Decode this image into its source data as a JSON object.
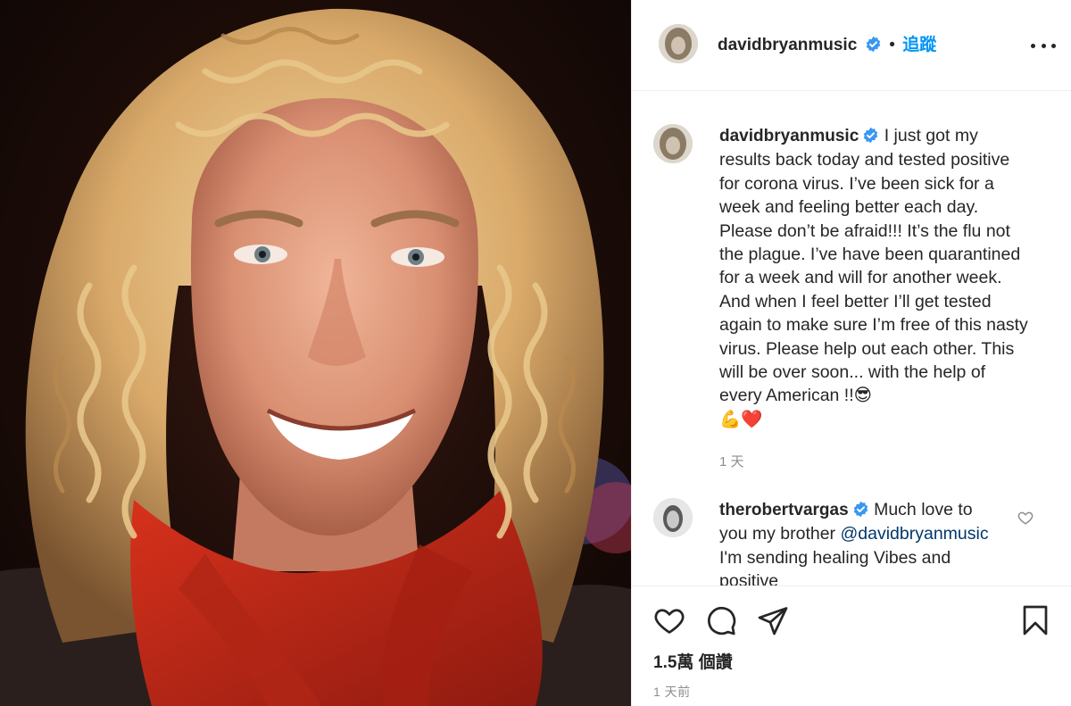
{
  "post": {
    "photo": {
      "description_icon": "portrait-photo"
    },
    "header": {
      "username": "davidbryanmusic",
      "separator": "•",
      "follow_label": "追蹤",
      "more_icon": "more-horizontal-icon"
    },
    "caption": {
      "username": "davidbryanmusic",
      "text": "I just got my results back today and tested positive for corona virus. I’ve been sick for a week and feeling better each day. Please don’t be afraid!!! It’s the flu not the plague. I’ve have been quarantined for a week and will for another week. And when I feel better I’ll get tested again to make sure I’m free of this nasty virus. Please help out each other. This will be over soon... with the help of every American !!",
      "emoji_end": "😎",
      "emoji_line2": "💪❤️",
      "time": "1 天"
    },
    "comment": {
      "username": "therobertvargas",
      "text_before": "Much love to you my brother",
      "mention": "@davidbryanmusic",
      "text_after": "I'm sending healing Vibes and positive"
    },
    "actions": {
      "like_icon": "heart-icon",
      "comment_icon": "comment-icon",
      "share_icon": "paper-plane-icon",
      "save_icon": "bookmark-icon"
    },
    "likes": "1.5萬 個讚",
    "time_ago": "1 天前",
    "colors": {
      "link": "#0095f6",
      "mention": "#00376b",
      "text": "#262626",
      "secondary": "#8e8e8e"
    }
  }
}
